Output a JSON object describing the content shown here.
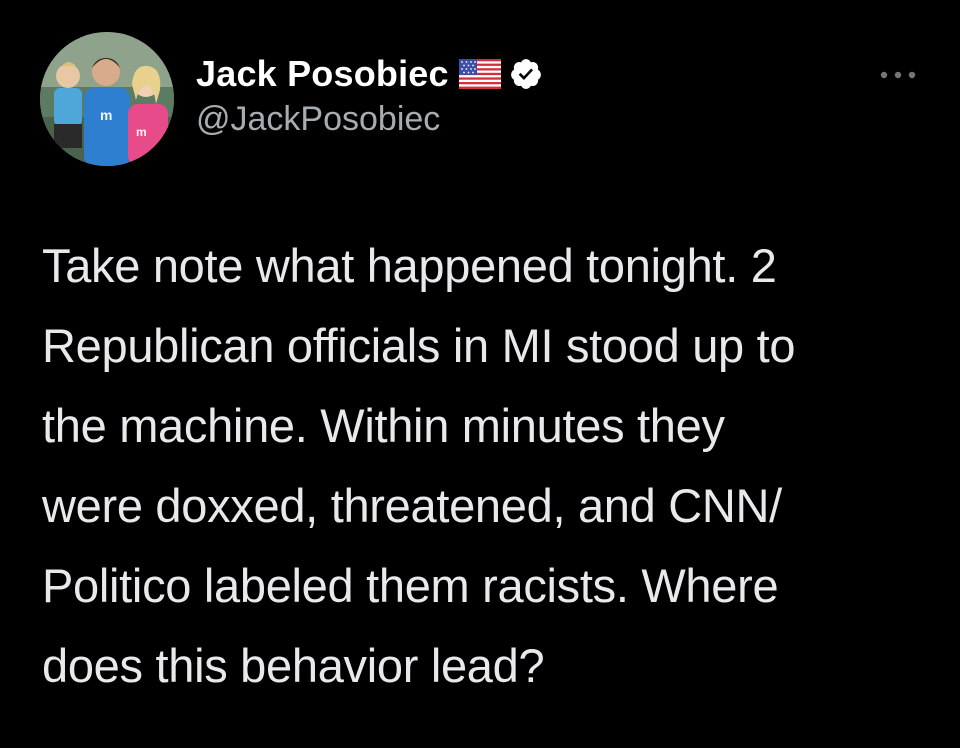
{
  "tweet": {
    "author": {
      "display_name": "Jack Posobiec",
      "flag_icon": "us-flag-icon",
      "verified_icon": "verified-badge-icon",
      "handle": "@JackPosobiec",
      "avatar_icon": "profile-photo"
    },
    "more_icon": "more-options-icon",
    "text": "Take note what happened tonight. 2\nRepublican officials in MI stood up to\nthe machine. Within minutes they\nwere doxxed, threatened, and CNN/\nPolitico labeled them racists. Where\ndoes this behavior lead?"
  },
  "colors": {
    "background": "#000000",
    "name": "#ffffff",
    "handle": "#a6acb2",
    "text": "#e7e9ea",
    "verified_badge": "#ffffff"
  }
}
